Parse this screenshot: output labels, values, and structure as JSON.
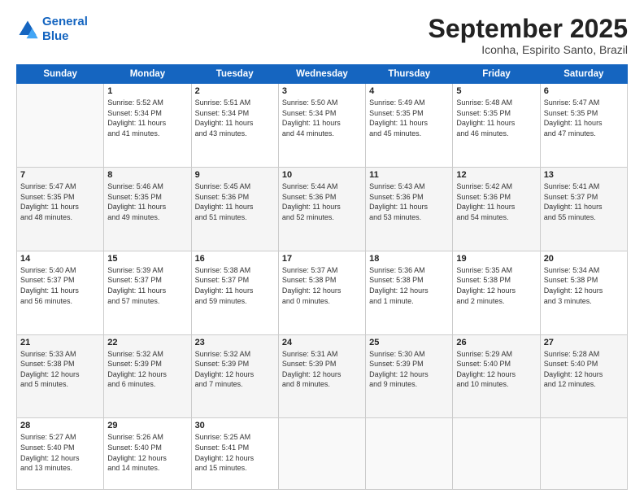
{
  "header": {
    "logo_line1": "General",
    "logo_line2": "Blue",
    "month": "September 2025",
    "location": "Iconha, Espirito Santo, Brazil"
  },
  "weekdays": [
    "Sunday",
    "Monday",
    "Tuesday",
    "Wednesday",
    "Thursday",
    "Friday",
    "Saturday"
  ],
  "weeks": [
    [
      {
        "day": "",
        "info": ""
      },
      {
        "day": "1",
        "info": "Sunrise: 5:52 AM\nSunset: 5:34 PM\nDaylight: 11 hours\nand 41 minutes."
      },
      {
        "day": "2",
        "info": "Sunrise: 5:51 AM\nSunset: 5:34 PM\nDaylight: 11 hours\nand 43 minutes."
      },
      {
        "day": "3",
        "info": "Sunrise: 5:50 AM\nSunset: 5:34 PM\nDaylight: 11 hours\nand 44 minutes."
      },
      {
        "day": "4",
        "info": "Sunrise: 5:49 AM\nSunset: 5:35 PM\nDaylight: 11 hours\nand 45 minutes."
      },
      {
        "day": "5",
        "info": "Sunrise: 5:48 AM\nSunset: 5:35 PM\nDaylight: 11 hours\nand 46 minutes."
      },
      {
        "day": "6",
        "info": "Sunrise: 5:47 AM\nSunset: 5:35 PM\nDaylight: 11 hours\nand 47 minutes."
      }
    ],
    [
      {
        "day": "7",
        "info": "Sunrise: 5:47 AM\nSunset: 5:35 PM\nDaylight: 11 hours\nand 48 minutes."
      },
      {
        "day": "8",
        "info": "Sunrise: 5:46 AM\nSunset: 5:35 PM\nDaylight: 11 hours\nand 49 minutes."
      },
      {
        "day": "9",
        "info": "Sunrise: 5:45 AM\nSunset: 5:36 PM\nDaylight: 11 hours\nand 51 minutes."
      },
      {
        "day": "10",
        "info": "Sunrise: 5:44 AM\nSunset: 5:36 PM\nDaylight: 11 hours\nand 52 minutes."
      },
      {
        "day": "11",
        "info": "Sunrise: 5:43 AM\nSunset: 5:36 PM\nDaylight: 11 hours\nand 53 minutes."
      },
      {
        "day": "12",
        "info": "Sunrise: 5:42 AM\nSunset: 5:36 PM\nDaylight: 11 hours\nand 54 minutes."
      },
      {
        "day": "13",
        "info": "Sunrise: 5:41 AM\nSunset: 5:37 PM\nDaylight: 11 hours\nand 55 minutes."
      }
    ],
    [
      {
        "day": "14",
        "info": "Sunrise: 5:40 AM\nSunset: 5:37 PM\nDaylight: 11 hours\nand 56 minutes."
      },
      {
        "day": "15",
        "info": "Sunrise: 5:39 AM\nSunset: 5:37 PM\nDaylight: 11 hours\nand 57 minutes."
      },
      {
        "day": "16",
        "info": "Sunrise: 5:38 AM\nSunset: 5:37 PM\nDaylight: 11 hours\nand 59 minutes."
      },
      {
        "day": "17",
        "info": "Sunrise: 5:37 AM\nSunset: 5:38 PM\nDaylight: 12 hours\nand 0 minutes."
      },
      {
        "day": "18",
        "info": "Sunrise: 5:36 AM\nSunset: 5:38 PM\nDaylight: 12 hours\nand 1 minute."
      },
      {
        "day": "19",
        "info": "Sunrise: 5:35 AM\nSunset: 5:38 PM\nDaylight: 12 hours\nand 2 minutes."
      },
      {
        "day": "20",
        "info": "Sunrise: 5:34 AM\nSunset: 5:38 PM\nDaylight: 12 hours\nand 3 minutes."
      }
    ],
    [
      {
        "day": "21",
        "info": "Sunrise: 5:33 AM\nSunset: 5:38 PM\nDaylight: 12 hours\nand 5 minutes."
      },
      {
        "day": "22",
        "info": "Sunrise: 5:32 AM\nSunset: 5:39 PM\nDaylight: 12 hours\nand 6 minutes."
      },
      {
        "day": "23",
        "info": "Sunrise: 5:32 AM\nSunset: 5:39 PM\nDaylight: 12 hours\nand 7 minutes."
      },
      {
        "day": "24",
        "info": "Sunrise: 5:31 AM\nSunset: 5:39 PM\nDaylight: 12 hours\nand 8 minutes."
      },
      {
        "day": "25",
        "info": "Sunrise: 5:30 AM\nSunset: 5:39 PM\nDaylight: 12 hours\nand 9 minutes."
      },
      {
        "day": "26",
        "info": "Sunrise: 5:29 AM\nSunset: 5:40 PM\nDaylight: 12 hours\nand 10 minutes."
      },
      {
        "day": "27",
        "info": "Sunrise: 5:28 AM\nSunset: 5:40 PM\nDaylight: 12 hours\nand 12 minutes."
      }
    ],
    [
      {
        "day": "28",
        "info": "Sunrise: 5:27 AM\nSunset: 5:40 PM\nDaylight: 12 hours\nand 13 minutes."
      },
      {
        "day": "29",
        "info": "Sunrise: 5:26 AM\nSunset: 5:40 PM\nDaylight: 12 hours\nand 14 minutes."
      },
      {
        "day": "30",
        "info": "Sunrise: 5:25 AM\nSunset: 5:41 PM\nDaylight: 12 hours\nand 15 minutes."
      },
      {
        "day": "",
        "info": ""
      },
      {
        "day": "",
        "info": ""
      },
      {
        "day": "",
        "info": ""
      },
      {
        "day": "",
        "info": ""
      }
    ]
  ]
}
